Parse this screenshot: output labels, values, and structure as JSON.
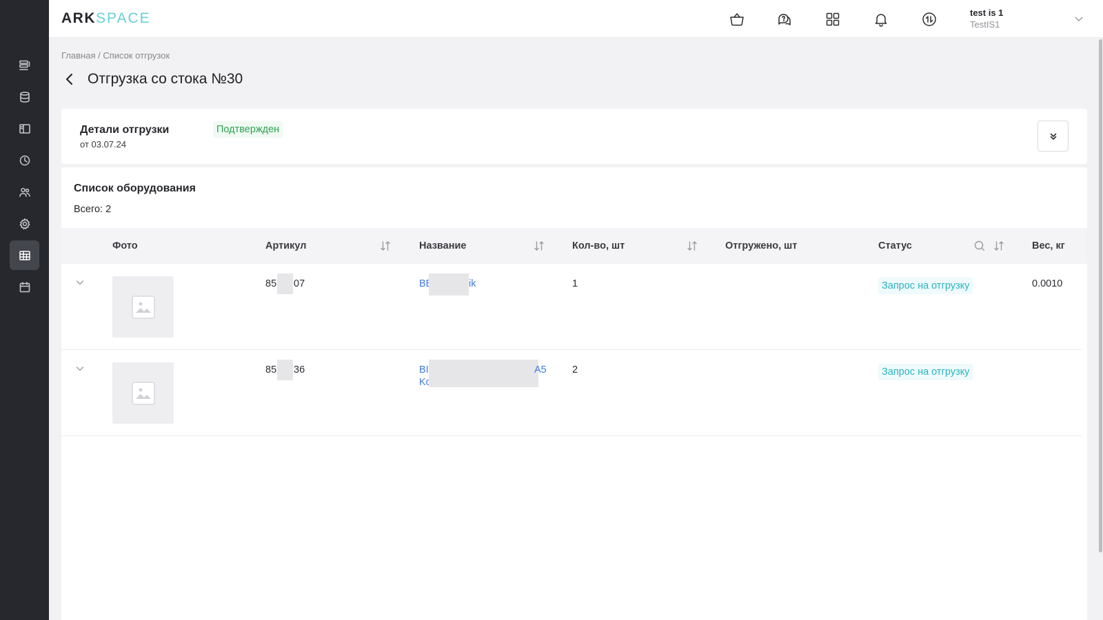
{
  "header": {
    "logo_bold": "ARK",
    "logo_light": "SPACE",
    "icons": [
      "basket-icon",
      "chat-help-icon",
      "apps-grid-icon",
      "bell-icon",
      "exchange-icon"
    ],
    "user_name": "test is 1",
    "user_company": "TestIS1"
  },
  "sidebar": {
    "items": [
      "list-icon",
      "database-icon",
      "layout-icon",
      "clock-icon",
      "users-icon",
      "gear-icon",
      "table-icon",
      "calendar-icon"
    ],
    "active_index": 6
  },
  "breadcrumb": "Главная / Список отгрузок",
  "page": {
    "title": "Отгрузка со стока №30"
  },
  "details": {
    "title": "Детали отгрузки",
    "date": "от 03.07.24",
    "status": "Подтвержден",
    "status_color": "#2ca24f"
  },
  "equipment": {
    "title": "Список оборудования",
    "total": "Всего: 2",
    "columns": {
      "photo": "Фото",
      "article": "Артикул",
      "name": "Название",
      "qty": "Кол-во, шт",
      "shipped": "Отгружено, шт",
      "status": "Статус",
      "weight": "Вес, кг"
    },
    "rows": [
      {
        "article_start": "85",
        "article_end": "07",
        "name_start": "BE",
        "name_end": "ik",
        "qty": "1",
        "shipped": "",
        "status": "Запрос на отгрузку",
        "weight": "0.0010"
      },
      {
        "article_start": "85",
        "article_end": "36",
        "name_start": "BI",
        "name_end": "A5",
        "name_line2": "Kc",
        "qty": "2",
        "shipped": "",
        "status": "Запрос на отгрузку",
        "weight": ""
      }
    ],
    "status_color": "#2ab3c2"
  }
}
